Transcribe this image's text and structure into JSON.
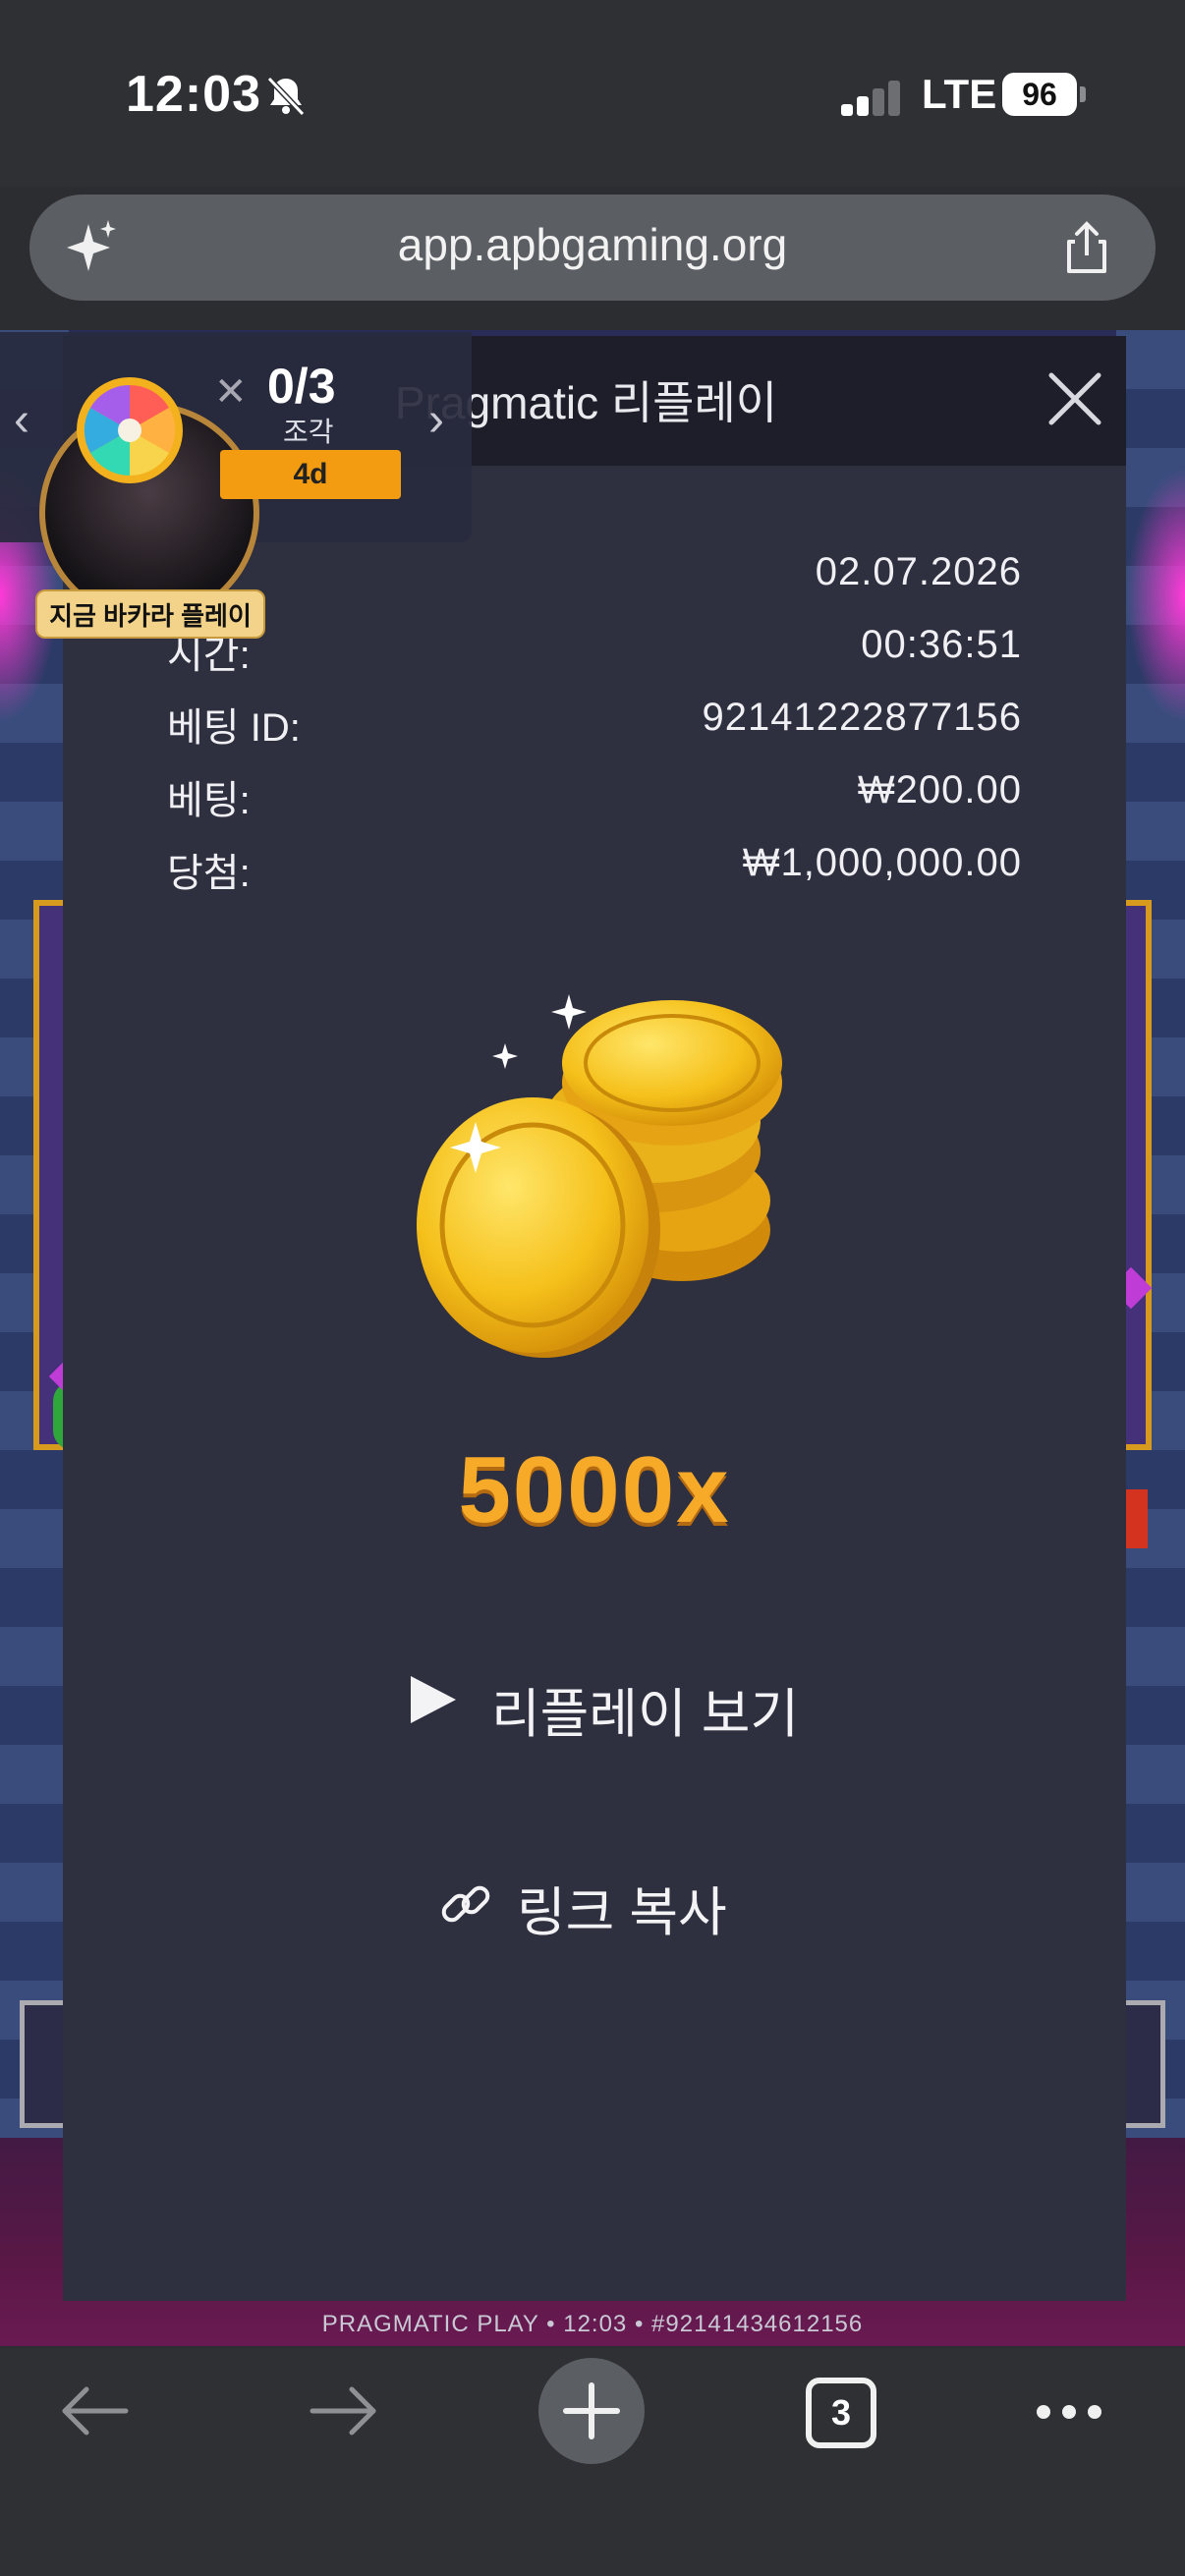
{
  "status_bar": {
    "time": "12:03",
    "network": "LTE",
    "battery": "96"
  },
  "browser": {
    "url": "app.apbgaming.org"
  },
  "overlay": {
    "count": "0/3",
    "pieces_label": "조각",
    "timer": "4d",
    "x": "✕",
    "chev_left": "‹",
    "chev_right": "›",
    "baccarat_cta": "지금 바카라 플레이"
  },
  "modal": {
    "title": "Pragmatic 리플레이",
    "rows": [
      {
        "label": "",
        "value": "02.07.2026"
      },
      {
        "label": "시간:",
        "value": "00:36:51"
      },
      {
        "label": "베팅 ID:",
        "value": "92141222877156"
      },
      {
        "label": "베팅:",
        "value": "₩200.00"
      },
      {
        "label": "당첨:",
        "value": "₩1,000,000.00"
      }
    ],
    "multiplier": "5000x",
    "replay_label": "리플레이 보기",
    "copy_link_label": "링크 복사"
  },
  "game": {
    "footer": "PRAGMATIC PLAY • 12:03 • #92141434612156"
  },
  "toolbar": {
    "tab_count": "3"
  },
  "colors": {
    "modal_bg": "#2e2f3f",
    "header_bg": "#1d1e2a",
    "accent_gold": "#f7a928",
    "timer_orange": "#f39c12"
  },
  "icons": [
    "bell-slash-icon",
    "signal-icon",
    "battery-icon",
    "sparkle-icon",
    "share-icon",
    "close-icon",
    "coins-icon",
    "play-icon",
    "link-icon",
    "back-arrow-icon",
    "forward-arrow-icon",
    "plus-icon",
    "tabs-icon",
    "more-icon",
    "prize-wheel-icon"
  ]
}
